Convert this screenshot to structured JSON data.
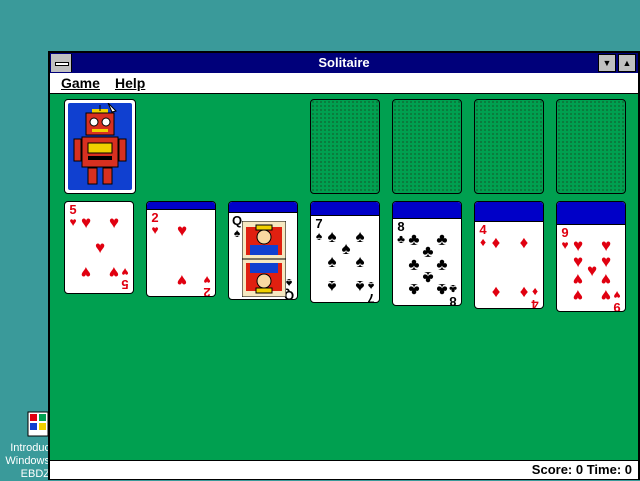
{
  "window": {
    "title": "Solitaire"
  },
  "menu": {
    "game": "Game",
    "help": "Help"
  },
  "status": {
    "text": "Score: 0 Time: 0"
  },
  "desktop_icon": {
    "label": "Introduc\nWindows\nEBDZ"
  },
  "stock": {
    "back_design": "robot"
  },
  "foundations": [
    {
      "slot": "foundation-1"
    },
    {
      "slot": "foundation-2"
    },
    {
      "slot": "foundation-3"
    },
    {
      "slot": "foundation-4"
    }
  ],
  "tableau": [
    {
      "rank": "5",
      "suit": "♥",
      "color": "red",
      "hidden": 0
    },
    {
      "rank": "2",
      "suit": "♥",
      "color": "red",
      "hidden": 1
    },
    {
      "rank": "Q",
      "suit": "♠",
      "color": "black",
      "hidden": 2
    },
    {
      "rank": "7",
      "suit": "♠",
      "color": "black",
      "hidden": 3
    },
    {
      "rank": "8",
      "suit": "♣",
      "color": "black",
      "hidden": 4
    },
    {
      "rank": "4",
      "suit": "♦",
      "color": "red",
      "hidden": 5
    },
    {
      "rank": "9",
      "suit": "♥",
      "color": "red",
      "hidden": 6
    }
  ],
  "colors": {
    "felt": "#00a050",
    "card_back": "#0000c8",
    "title_bar": "#00007a",
    "red_suit": "#e00010"
  }
}
